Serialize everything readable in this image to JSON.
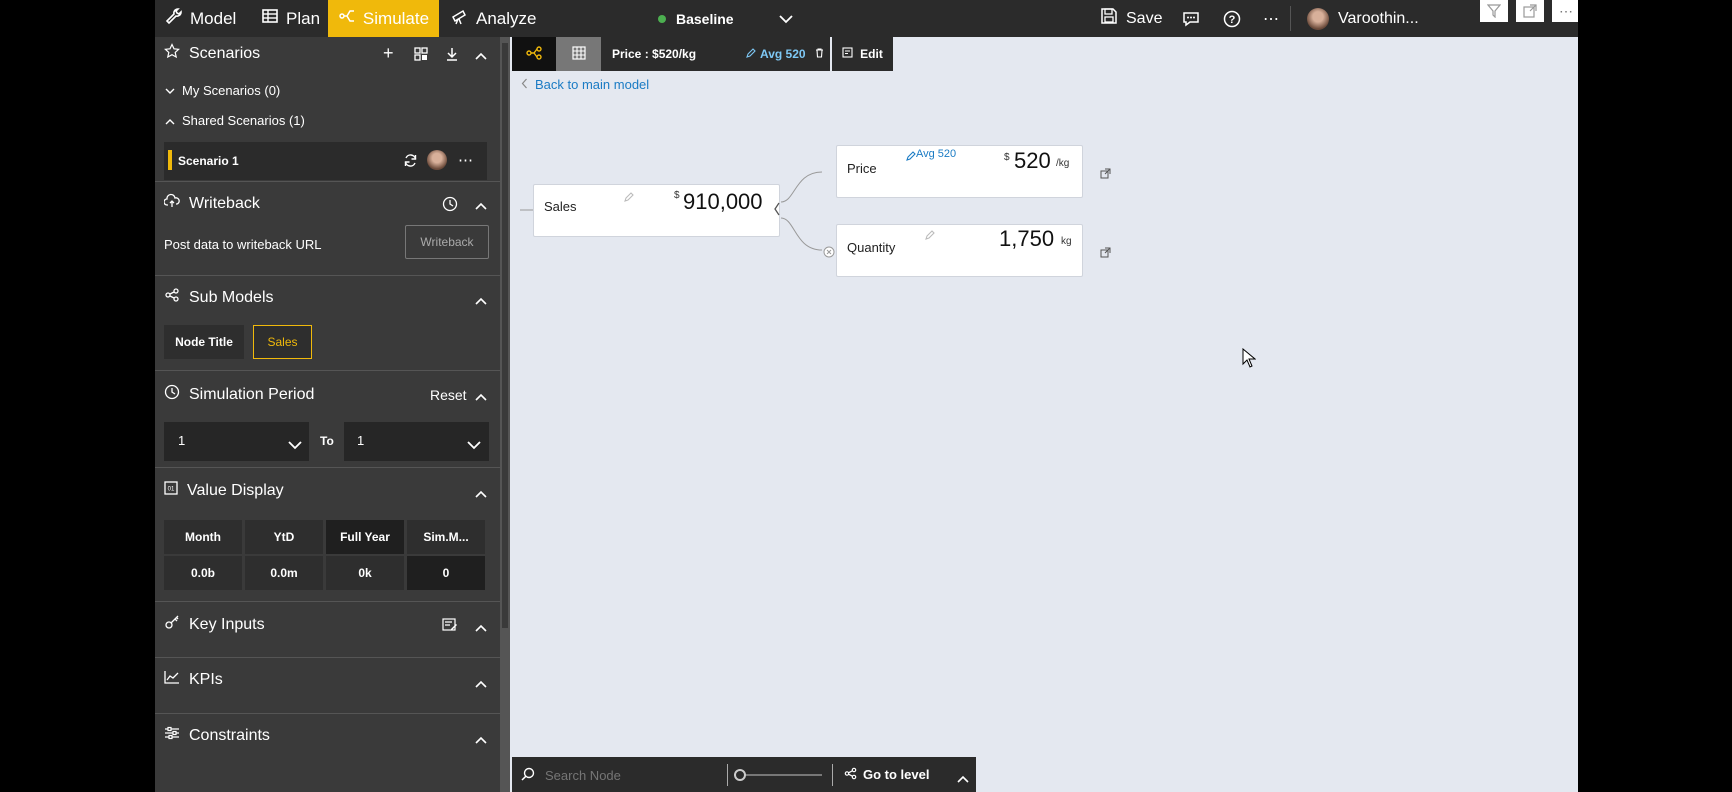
{
  "topbar": {
    "tabs": [
      {
        "label": "Model",
        "icon": "wrench-icon"
      },
      {
        "label": "Plan",
        "icon": "table-icon"
      },
      {
        "label": "Simulate",
        "icon": "simulate-icon",
        "active": true
      },
      {
        "label": "Analyze",
        "icon": "telescope-icon"
      }
    ],
    "scenario": "Baseline",
    "save_label": "Save",
    "user_name": "Varoothin..."
  },
  "sidebar": {
    "scenarios": {
      "title": "Scenarios",
      "my_scenarios": "My Scenarios (0)",
      "shared_scenarios": "Shared Scenarios (1)",
      "scenario_item": "Scenario 1"
    },
    "writeback": {
      "title": "Writeback",
      "description": "Post data to writeback URL",
      "button": "Writeback"
    },
    "sub_models": {
      "title": "Sub Models",
      "node_title": "Node Title",
      "sales": "Sales"
    },
    "simulation_period": {
      "title": "Simulation Period",
      "reset": "Reset",
      "from": "1",
      "to_label": "To",
      "to": "1"
    },
    "value_display": {
      "title": "Value Display",
      "headers": [
        "Month",
        "YtD",
        "Full Year",
        "Sim.M..."
      ],
      "values": [
        "0.0b",
        "0.0m",
        "0k",
        "0"
      ]
    },
    "key_inputs": {
      "title": "Key Inputs"
    },
    "kpis": {
      "title": "KPIs"
    },
    "constraints": {
      "title": "Constraints"
    }
  },
  "canvas": {
    "toolbar": {
      "price_label": "Price : $520/kg",
      "avg_label": "Avg 520",
      "edit_label": "Edit"
    },
    "back_link": "Back to main model",
    "nodes": {
      "sales": {
        "title": "Sales",
        "currency": "$",
        "value": "910,000"
      },
      "price": {
        "title": "Price",
        "avg": "Avg 520",
        "currency": "$",
        "value": "520",
        "unit": "/kg"
      },
      "quantity": {
        "title": "Quantity",
        "value": "1,750",
        "unit": "kg"
      }
    },
    "bottombar": {
      "search_placeholder": "Search Node",
      "go_to_level": "Go to level"
    }
  },
  "colors": {
    "accent": "#f0b90b",
    "link": "#1a7bc4",
    "status_green": "#4caf50"
  }
}
